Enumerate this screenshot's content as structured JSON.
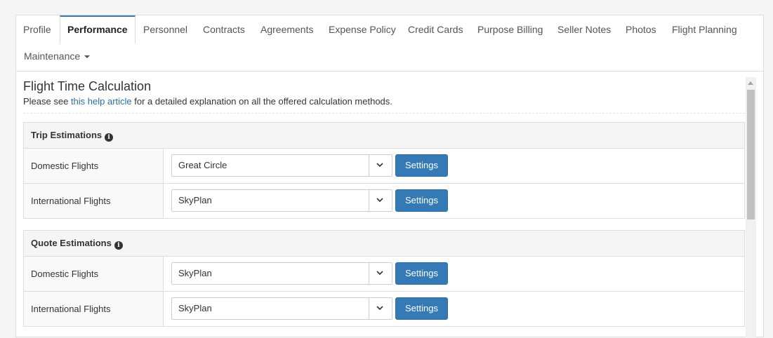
{
  "tabs": [
    {
      "label": "Profile"
    },
    {
      "label": "Performance"
    },
    {
      "label": "Personnel"
    },
    {
      "label": "Contracts"
    },
    {
      "label": "Agreements"
    },
    {
      "label": "Expense Policy"
    },
    {
      "label": "Credit Cards"
    },
    {
      "label": "Purpose Billing"
    },
    {
      "label": "Seller Notes"
    },
    {
      "label": "Photos"
    },
    {
      "label": "Flight Planning"
    },
    {
      "label": "Maintenance"
    }
  ],
  "active_tab": "Performance",
  "page": {
    "title": "Flight Time Calculation",
    "desc_prefix": "Please see ",
    "desc_link": "this help article",
    "desc_suffix": " for a detailed explanation on all the offered calculation methods."
  },
  "sections": [
    {
      "title": "Trip Estimations",
      "rows": [
        {
          "label": "Domestic Flights",
          "value": "Great Circle",
          "button": "Settings"
        },
        {
          "label": "International Flights",
          "value": "SkyPlan",
          "button": "Settings"
        }
      ]
    },
    {
      "title": "Quote Estimations",
      "rows": [
        {
          "label": "Domestic Flights",
          "value": "SkyPlan",
          "button": "Settings"
        },
        {
          "label": "International Flights",
          "value": "SkyPlan",
          "button": "Settings"
        }
      ]
    }
  ],
  "colors": {
    "primary": "#337ab7",
    "link": "#2a6ea6",
    "tab_active_border": "#3a7aa8"
  }
}
